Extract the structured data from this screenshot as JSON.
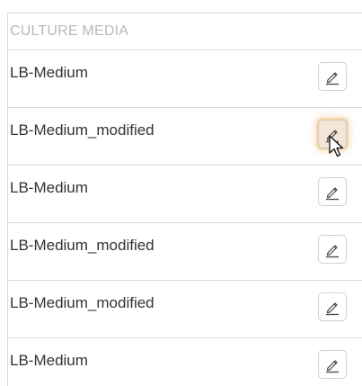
{
  "table": {
    "header": "CULTURE MEDIA",
    "rows": [
      {
        "label": "LB-Medium"
      },
      {
        "label": "LB-Medium_modified"
      },
      {
        "label": "LB-Medium"
      },
      {
        "label": "LB-Medium_modified"
      },
      {
        "label": "LB-Medium_modified"
      },
      {
        "label": "LB-Medium"
      }
    ]
  },
  "icons": {
    "edit": "pencil-icon",
    "pointer": "mouse-pointer-icon"
  },
  "colors": {
    "border": "#d9d9d9",
    "header_text": "#b9b9b9",
    "row_text": "#333333",
    "hover_glow": "#f5d7b0"
  }
}
